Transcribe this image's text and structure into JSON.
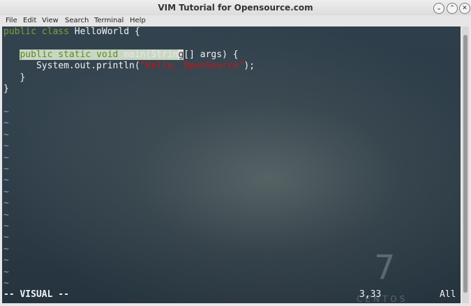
{
  "window": {
    "title": "VIM Tutorial for Opensource.com"
  },
  "menu": [
    "File",
    "Edit",
    "View",
    "Search",
    "Terminal",
    "Help"
  ],
  "code": {
    "line1": {
      "kw": "public class",
      "rest": " HelloWorld {"
    },
    "line3": {
      "indent": "   ",
      "kw_sel": "public static void",
      "sel_plain": " main(Strin",
      "cursor": "g",
      "rest": "[] args) {"
    },
    "line4": {
      "indent": "      ",
      "prefix": "System.out.println(",
      "string": "\"Hello, OpenSource\"",
      "suffix": ");"
    },
    "line5": "   }",
    "line6": "}",
    "tilde": "~"
  },
  "status": {
    "mode": "-- VISUAL --",
    "position": "3,33",
    "scroll": "All"
  },
  "watermark": {
    "number": "7",
    "brand": "CENTOS"
  }
}
